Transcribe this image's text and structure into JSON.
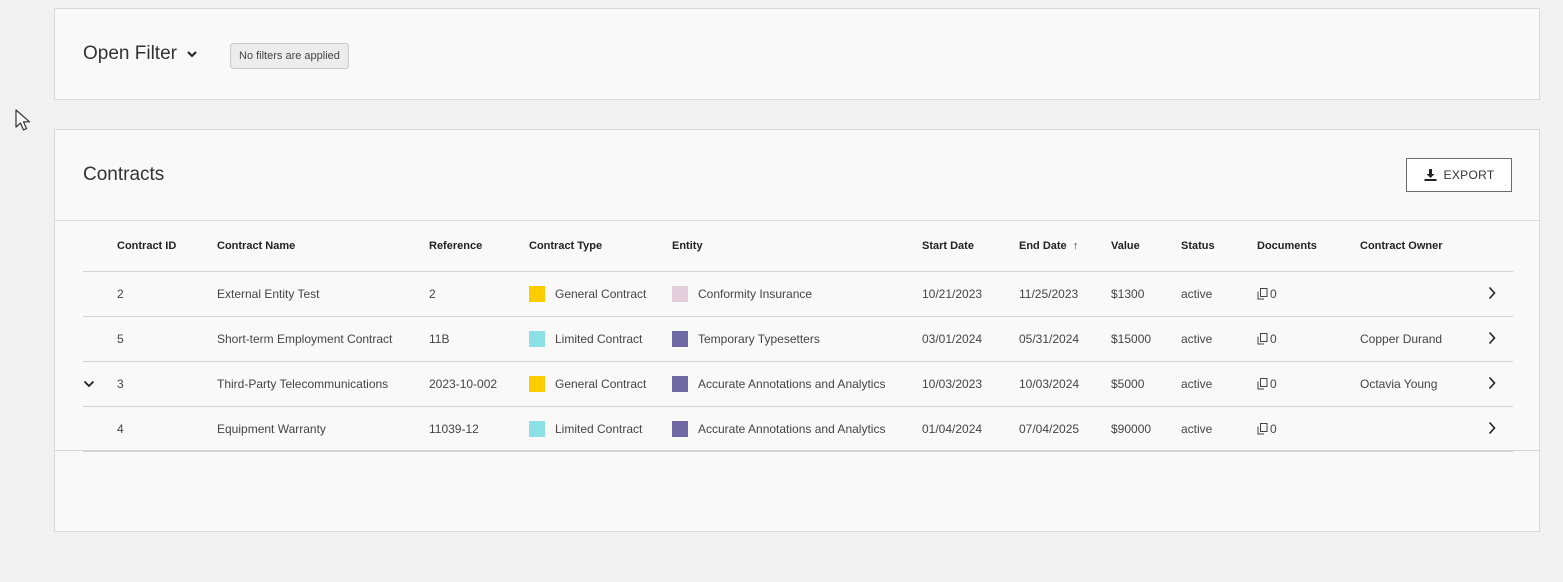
{
  "filter": {
    "toggle_label": "Open Filter",
    "status_badge": "No filters are applied"
  },
  "contracts": {
    "title": "Contracts",
    "export_label": "EXPORT",
    "columns": {
      "contract_id": "Contract ID",
      "contract_name": "Contract Name",
      "reference": "Reference",
      "contract_type": "Contract Type",
      "entity": "Entity",
      "start_date": "Start Date",
      "end_date": "End Date",
      "value": "Value",
      "status": "Status",
      "documents": "Documents",
      "contract_owner": "Contract Owner"
    },
    "sort": {
      "column": "end_date",
      "direction": "ascending"
    },
    "rows": [
      {
        "id": "2",
        "name": "External Entity Test",
        "reference": "2",
        "type": "General Contract",
        "type_color": "#f9cd00",
        "entity": "Conformity Insurance",
        "entity_color": "#e3cfdc",
        "start": "10/21/2023",
        "end": "11/25/2023",
        "value": "$1300",
        "status": "active",
        "documents": "0",
        "owner": "",
        "expanded": false
      },
      {
        "id": "5",
        "name": "Short-term Employment Contract",
        "reference": "11B",
        "type": "Limited Contract",
        "type_color": "#8ce0e5",
        "entity": "Temporary Typesetters",
        "entity_color": "#6f6aa3",
        "start": "03/01/2024",
        "end": "05/31/2024",
        "value": "$15000",
        "status": "active",
        "documents": "0",
        "owner": "Copper Durand",
        "expanded": false
      },
      {
        "id": "3",
        "name": "Third-Party Telecommunications",
        "reference": "2023-10-002",
        "type": "General Contract",
        "type_color": "#f9cd00",
        "entity": "Accurate Annotations and Analytics",
        "entity_color": "#6f6aa3",
        "start": "10/03/2023",
        "end": "10/03/2024",
        "value": "$5000",
        "status": "active",
        "documents": "0",
        "owner": "Octavia Young",
        "expanded": true
      },
      {
        "id": "4",
        "name": "Equipment Warranty",
        "reference": "11039-12",
        "type": "Limited Contract",
        "type_color": "#8ce0e5",
        "entity": "Accurate Annotations and Analytics",
        "entity_color": "#6f6aa3",
        "start": "01/04/2024",
        "end": "07/04/2025",
        "value": "$90000",
        "status": "active",
        "documents": "0",
        "owner": "",
        "expanded": false
      }
    ]
  }
}
